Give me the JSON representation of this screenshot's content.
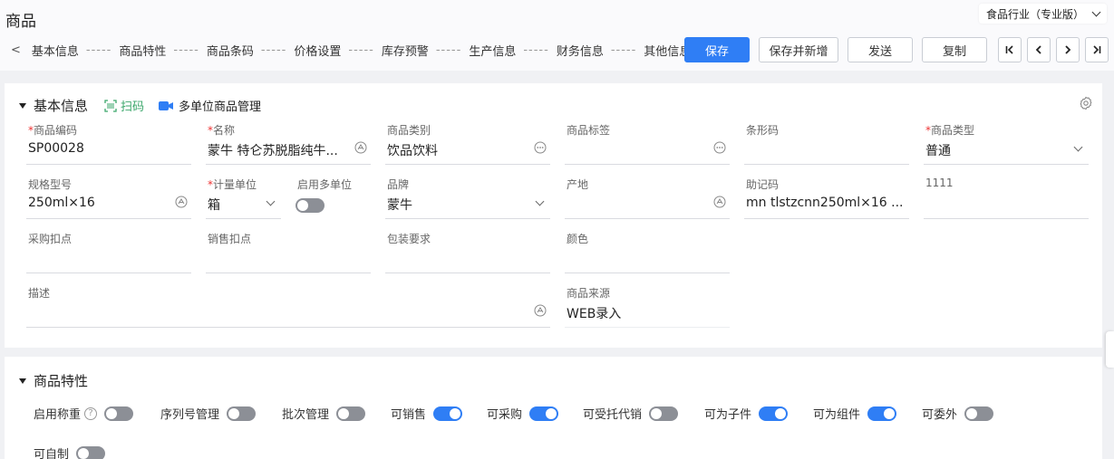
{
  "page": {
    "title": "商品",
    "industry": "食品行业（专业版）"
  },
  "nav": {
    "prev": "<",
    "next": ">",
    "items": [
      "基本信息",
      "商品特性",
      "商品条码",
      "价格设置",
      "库存预警",
      "生产信息",
      "财务信息",
      "其他信息"
    ],
    "separator": "-----"
  },
  "actions": {
    "save": "保存",
    "save_new": "保存并新增",
    "send": "发送",
    "copy": "复制"
  },
  "basic": {
    "title": "基本信息",
    "scan": "扫码",
    "multi_unit": "多单位商品管理",
    "code_label": "商品编码",
    "code_value": "SP00028",
    "name_label": "名称",
    "name_value": "蒙牛 特仑苏脱脂纯牛...",
    "category_label": "商品类别",
    "category_value": "饮品饮料",
    "tag_label": "商品标签",
    "barcode_label": "条形码",
    "type_label": "商品类型",
    "type_value": "普通",
    "spec_label": "规格型号",
    "spec_value": "250ml×16",
    "unit_label": "计量单位",
    "unit_value": "箱",
    "multi_unit_label": "启用多单位",
    "brand_label": "品牌",
    "brand_value": "蒙牛",
    "origin_label": "产地",
    "mnemonic_label": "助记码",
    "mnemonic_value": "mn tlstzcnn250ml×16 ...",
    "custom_label": "1111",
    "purchase_discount_label": "采购扣点",
    "sales_discount_label": "销售扣点",
    "packing_label": "包装要求",
    "color_label": "颜色",
    "desc_label": "描述",
    "source_label": "商品来源",
    "source_value": "WEB录入"
  },
  "features": {
    "title": "商品特性",
    "items": [
      {
        "label": "启用称重",
        "on": false,
        "help": "?"
      },
      {
        "label": "序列号管理",
        "on": false
      },
      {
        "label": "批次管理",
        "on": false
      },
      {
        "label": "可销售",
        "on": true
      },
      {
        "label": "可采购",
        "on": true
      },
      {
        "label": "可受托代销",
        "on": false
      },
      {
        "label": "可为子件",
        "on": true
      },
      {
        "label": "可为组件",
        "on": true
      },
      {
        "label": "可委外",
        "on": false
      },
      {
        "label": "可自制",
        "on": false
      }
    ]
  },
  "colors": {
    "primary": "#2f7ef5",
    "toggle_off": "#8c8f96",
    "required": "#e33333",
    "scan": "#3aa66a"
  }
}
